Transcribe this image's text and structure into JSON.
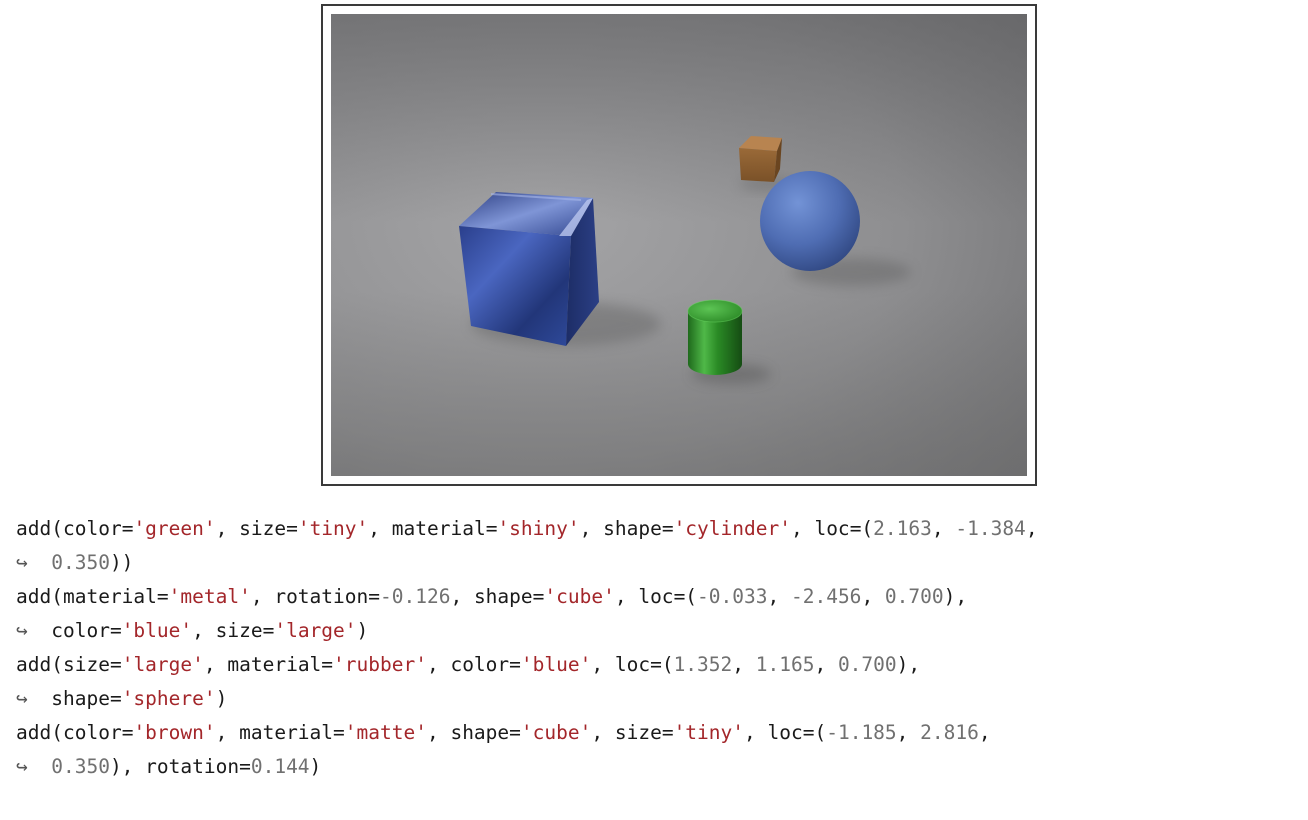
{
  "figure": {
    "description_icon": "rendered-3d-scene-image",
    "objects": [
      {
        "name": "blue-metal-cube",
        "color": "#2f4f9e"
      },
      {
        "name": "brown-matte-cube",
        "color": "#9a6a3a"
      },
      {
        "name": "blue-rubber-sphere",
        "color": "#5273b8"
      },
      {
        "name": "green-shiny-cylinder",
        "color": "#2f8a2a"
      }
    ]
  },
  "code": {
    "colors": {
      "keyword": "#1a1a1a",
      "string": "#a3262a",
      "number": "#707070",
      "continuation": "#555555"
    },
    "continuation_glyph": "↪",
    "lines": [
      [
        {
          "t": "fn",
          "v": "add"
        },
        {
          "t": "p",
          "v": "("
        },
        {
          "t": "arg",
          "v": "color"
        },
        {
          "t": "p",
          "v": "="
        },
        {
          "t": "str",
          "v": "'green'"
        },
        {
          "t": "p",
          "v": ", "
        },
        {
          "t": "arg",
          "v": "size"
        },
        {
          "t": "p",
          "v": "="
        },
        {
          "t": "str",
          "v": "'tiny'"
        },
        {
          "t": "p",
          "v": ", "
        },
        {
          "t": "arg",
          "v": "material"
        },
        {
          "t": "p",
          "v": "="
        },
        {
          "t": "str",
          "v": "'shiny'"
        },
        {
          "t": "p",
          "v": ", "
        },
        {
          "t": "arg",
          "v": "shape"
        },
        {
          "t": "p",
          "v": "="
        },
        {
          "t": "str",
          "v": "'cylinder'"
        },
        {
          "t": "p",
          "v": ", "
        },
        {
          "t": "arg",
          "v": "loc"
        },
        {
          "t": "p",
          "v": "=("
        },
        {
          "t": "num",
          "v": "2.163"
        },
        {
          "t": "p",
          "v": ", "
        },
        {
          "t": "num",
          "v": "-1.384"
        },
        {
          "t": "p",
          "v": ","
        }
      ],
      [
        {
          "t": "cont",
          "v": "↪  "
        },
        {
          "t": "num",
          "v": "0.350"
        },
        {
          "t": "p",
          "v": "))"
        }
      ],
      [
        {
          "t": "fn",
          "v": "add"
        },
        {
          "t": "p",
          "v": "("
        },
        {
          "t": "arg",
          "v": "material"
        },
        {
          "t": "p",
          "v": "="
        },
        {
          "t": "str",
          "v": "'metal'"
        },
        {
          "t": "p",
          "v": ", "
        },
        {
          "t": "arg",
          "v": "rotation"
        },
        {
          "t": "p",
          "v": "="
        },
        {
          "t": "num",
          "v": "-0.126"
        },
        {
          "t": "p",
          "v": ", "
        },
        {
          "t": "arg",
          "v": "shape"
        },
        {
          "t": "p",
          "v": "="
        },
        {
          "t": "str",
          "v": "'cube'"
        },
        {
          "t": "p",
          "v": ", "
        },
        {
          "t": "arg",
          "v": "loc"
        },
        {
          "t": "p",
          "v": "=("
        },
        {
          "t": "num",
          "v": "-0.033"
        },
        {
          "t": "p",
          "v": ", "
        },
        {
          "t": "num",
          "v": "-2.456"
        },
        {
          "t": "p",
          "v": ", "
        },
        {
          "t": "num",
          "v": "0.700"
        },
        {
          "t": "p",
          "v": "),"
        }
      ],
      [
        {
          "t": "cont",
          "v": "↪  "
        },
        {
          "t": "arg",
          "v": "color"
        },
        {
          "t": "p",
          "v": "="
        },
        {
          "t": "str",
          "v": "'blue'"
        },
        {
          "t": "p",
          "v": ", "
        },
        {
          "t": "arg",
          "v": "size"
        },
        {
          "t": "p",
          "v": "="
        },
        {
          "t": "str",
          "v": "'large'"
        },
        {
          "t": "p",
          "v": ")"
        }
      ],
      [
        {
          "t": "fn",
          "v": "add"
        },
        {
          "t": "p",
          "v": "("
        },
        {
          "t": "arg",
          "v": "size"
        },
        {
          "t": "p",
          "v": "="
        },
        {
          "t": "str",
          "v": "'large'"
        },
        {
          "t": "p",
          "v": ", "
        },
        {
          "t": "arg",
          "v": "material"
        },
        {
          "t": "p",
          "v": "="
        },
        {
          "t": "str",
          "v": "'rubber'"
        },
        {
          "t": "p",
          "v": ", "
        },
        {
          "t": "arg",
          "v": "color"
        },
        {
          "t": "p",
          "v": "="
        },
        {
          "t": "str",
          "v": "'blue'"
        },
        {
          "t": "p",
          "v": ", "
        },
        {
          "t": "arg",
          "v": "loc"
        },
        {
          "t": "p",
          "v": "=("
        },
        {
          "t": "num",
          "v": "1.352"
        },
        {
          "t": "p",
          "v": ", "
        },
        {
          "t": "num",
          "v": "1.165"
        },
        {
          "t": "p",
          "v": ", "
        },
        {
          "t": "num",
          "v": "0.700"
        },
        {
          "t": "p",
          "v": "),"
        }
      ],
      [
        {
          "t": "cont",
          "v": "↪  "
        },
        {
          "t": "arg",
          "v": "shape"
        },
        {
          "t": "p",
          "v": "="
        },
        {
          "t": "str",
          "v": "'sphere'"
        },
        {
          "t": "p",
          "v": ")"
        }
      ],
      [
        {
          "t": "fn",
          "v": "add"
        },
        {
          "t": "p",
          "v": "("
        },
        {
          "t": "arg",
          "v": "color"
        },
        {
          "t": "p",
          "v": "="
        },
        {
          "t": "str",
          "v": "'brown'"
        },
        {
          "t": "p",
          "v": ", "
        },
        {
          "t": "arg",
          "v": "material"
        },
        {
          "t": "p",
          "v": "="
        },
        {
          "t": "str",
          "v": "'matte'"
        },
        {
          "t": "p",
          "v": ", "
        },
        {
          "t": "arg",
          "v": "shape"
        },
        {
          "t": "p",
          "v": "="
        },
        {
          "t": "str",
          "v": "'cube'"
        },
        {
          "t": "p",
          "v": ", "
        },
        {
          "t": "arg",
          "v": "size"
        },
        {
          "t": "p",
          "v": "="
        },
        {
          "t": "str",
          "v": "'tiny'"
        },
        {
          "t": "p",
          "v": ", "
        },
        {
          "t": "arg",
          "v": "loc"
        },
        {
          "t": "p",
          "v": "=("
        },
        {
          "t": "num",
          "v": "-1.185"
        },
        {
          "t": "p",
          "v": ", "
        },
        {
          "t": "num",
          "v": "2.816"
        },
        {
          "t": "p",
          "v": ","
        }
      ],
      [
        {
          "t": "cont",
          "v": "↪  "
        },
        {
          "t": "num",
          "v": "0.350"
        },
        {
          "t": "p",
          "v": "), "
        },
        {
          "t": "arg",
          "v": "rotation"
        },
        {
          "t": "p",
          "v": "="
        },
        {
          "t": "num",
          "v": "0.144"
        },
        {
          "t": "p",
          "v": ")"
        }
      ]
    ]
  }
}
